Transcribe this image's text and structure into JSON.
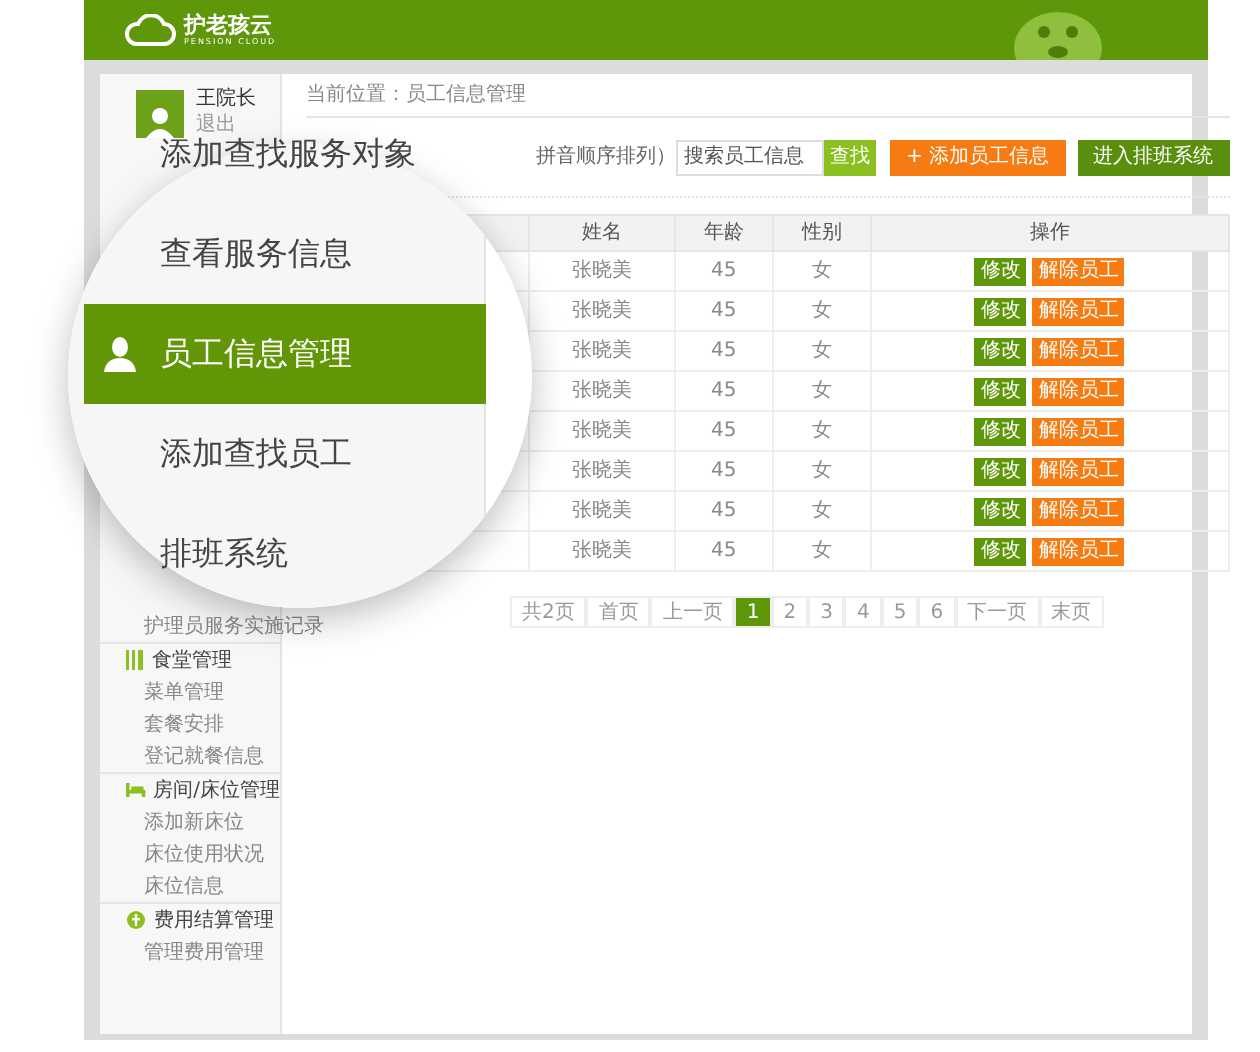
{
  "header": {
    "logo_title": "护老孩云",
    "logo_subtitle": "PENSION CLOUD"
  },
  "user": {
    "name": "王院长",
    "logout": "退出"
  },
  "sidebar": {
    "sections": [
      {
        "items": [
          "护理员服务实施记录"
        ]
      },
      {
        "kind": "dining",
        "title": "食堂管理",
        "items": [
          "菜单管理",
          "套餐安排",
          "登记就餐信息"
        ]
      },
      {
        "kind": "room",
        "title": "房间/床位管理",
        "items": [
          "添加新床位",
          "床位使用状况",
          "床位信息"
        ]
      },
      {
        "kind": "billing",
        "title": "费用结算管理",
        "items": [
          "管理费用管理"
        ]
      }
    ]
  },
  "magnifier": {
    "items": [
      {
        "label": "添加查找服务对象",
        "selected": false
      },
      {
        "label": "查看服务信息",
        "selected": false
      },
      {
        "label": "员工信息管理",
        "selected": true
      },
      {
        "label": "添加查找员工",
        "selected": false
      },
      {
        "label": "排班系统",
        "selected": false
      }
    ]
  },
  "breadcrumb": "当前位置：员工信息管理",
  "title": "拼音顺序排列）",
  "search": {
    "placeholder": "搜索员工信息",
    "button": "查找"
  },
  "actions": [
    {
      "label": "+ 添加员工信息",
      "kind": "primary"
    },
    {
      "label": "进入排班系统",
      "kind": "secondary"
    }
  ],
  "table": {
    "columns": [
      "姓名",
      "年龄",
      "性别",
      "操作"
    ],
    "rows": [
      {
        "name": "张晓美",
        "age": "45",
        "gender": "女",
        "actions": [
          "修改",
          "解除员工"
        ]
      },
      {
        "name": "张晓美",
        "age": "45",
        "gender": "女",
        "actions": [
          "修改",
          "解除员工"
        ]
      },
      {
        "name": "张晓美",
        "age": "45",
        "gender": "女",
        "actions": [
          "修改",
          "解除员工"
        ]
      },
      {
        "name": "张晓美",
        "age": "45",
        "gender": "女",
        "actions": [
          "修改",
          "解除员工"
        ]
      },
      {
        "name": "张晓美",
        "age": "45",
        "gender": "女",
        "actions": [
          "修改",
          "解除员工"
        ]
      },
      {
        "name": "张晓美",
        "age": "45",
        "gender": "女",
        "actions": [
          "修改",
          "解除员工"
        ]
      },
      {
        "name": "张晓美",
        "age": "45",
        "gender": "女",
        "actions": [
          "修改",
          "解除员工"
        ]
      },
      {
        "name": "张晓美",
        "age": "45",
        "gender": "女",
        "actions": [
          "修改",
          "解除员工"
        ]
      }
    ]
  },
  "pagination": {
    "items": [
      {
        "label": "共2页",
        "selected": false
      },
      {
        "label": "首页",
        "selected": false
      },
      {
        "label": "上一页",
        "selected": false
      },
      {
        "label": "1",
        "selected": true
      },
      {
        "label": "2",
        "selected": false
      },
      {
        "label": "3",
        "selected": false
      },
      {
        "label": "4",
        "selected": false
      },
      {
        "label": "5",
        "selected": false
      },
      {
        "label": "6",
        "selected": false
      },
      {
        "label": "下一页",
        "selected": false
      },
      {
        "label": "末页",
        "selected": false
      }
    ]
  }
}
